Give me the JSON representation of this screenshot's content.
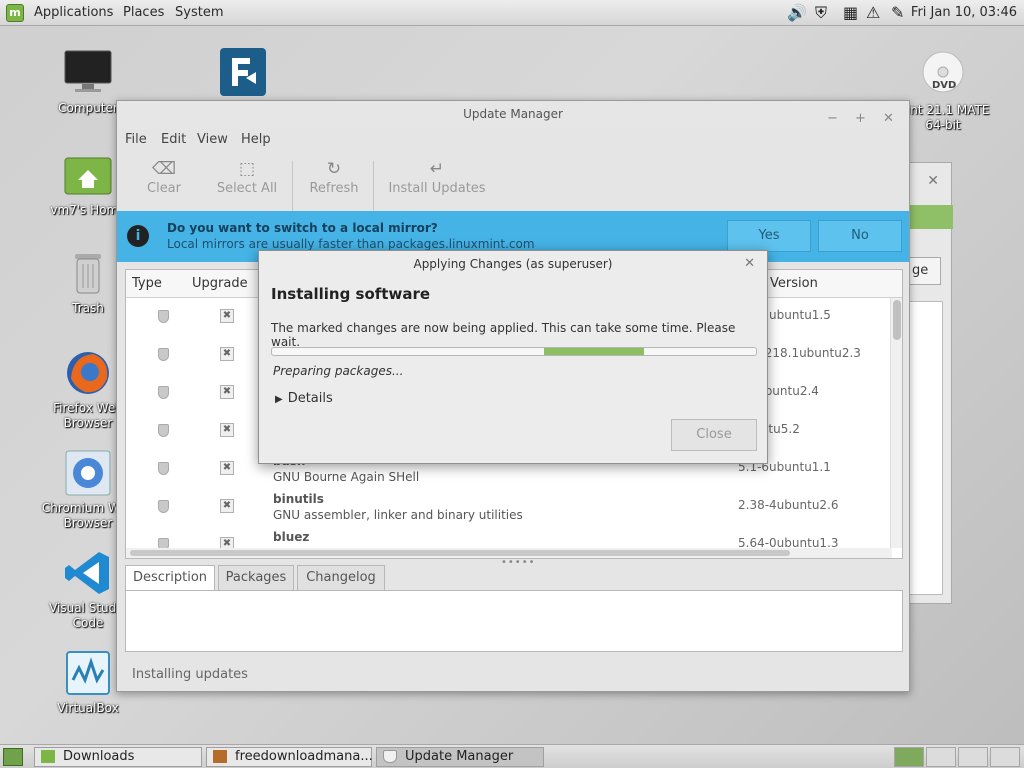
{
  "top_panel": {
    "menus": [
      "Applications",
      "Places",
      "System"
    ],
    "clock": "Fri Jan 10, 03:46"
  },
  "desktop": {
    "icons": [
      {
        "label": "Computer",
        "icon": "monitor-icon"
      },
      {
        "label": "vm7's Home",
        "icon": "home-folder-icon"
      },
      {
        "label": "Trash",
        "icon": "trash-icon"
      },
      {
        "label": "Firefox Web Browser",
        "icon": "firefox-icon"
      },
      {
        "label": "Chromium Web Browser",
        "icon": "chromium-icon"
      },
      {
        "label": "Visual Studio Code",
        "icon": "vscode-icon"
      },
      {
        "label": "VirtualBox",
        "icon": "virtualbox-icon"
      },
      {
        "label": "Mint 21.1 MATE 64-bit",
        "icon": "dvd-icon"
      }
    ]
  },
  "update_manager": {
    "title": "Update Manager",
    "menus": [
      "File",
      "Edit",
      "View",
      "Help"
    ],
    "toolbar": {
      "clear": "Clear",
      "select_all": "Select All",
      "refresh": "Refresh",
      "install": "Install Updates"
    },
    "mirror": {
      "question": "Do you want to switch to a local mirror?",
      "subtext": "Local mirrors are usually faster than packages.linuxmint.com",
      "yes": "Yes",
      "no": "No"
    },
    "columns": {
      "type": "Type",
      "upgrade": "Upgrade",
      "version": "Version"
    },
    "rows": [
      {
        "name": "",
        "desc": "",
        "version": "7.5-2ubuntu1.5"
      },
      {
        "name": "",
        "desc": "",
        "version": "2.91218.1ubuntu2.3"
      },
      {
        "name": "",
        "desc": "",
        "version": "3.2ubuntu2.4"
      },
      {
        "name": "",
        "desc": "",
        "version": "ubuntu5.2"
      },
      {
        "name": "bash",
        "desc": "GNU Bourne Again SHell",
        "version": "5.1-6ubuntu1.1"
      },
      {
        "name": "binutils",
        "desc": "GNU assembler, linker and binary utilities",
        "version": "2.38-4ubuntu2.6"
      },
      {
        "name": "bluez",
        "desc": "",
        "version": "5.64-0ubuntu1.3"
      }
    ],
    "tabs": [
      "Description",
      "Packages",
      "Changelog"
    ],
    "status": "Installing updates"
  },
  "dialog": {
    "title": "Applying Changes (as superuser)",
    "heading": "Installing software",
    "message": "The marked changes are now being applied. This can take some time. Please wait.",
    "state": "Preparing packages...",
    "details": "Details",
    "close": "Close"
  },
  "taskbar": {
    "tasks": [
      "Downloads",
      "freedownloadmana...",
      "Update Manager"
    ]
  },
  "colors": {
    "mirror_bar": "#45b3e6",
    "progress": "#8cbf62",
    "mint_green": "#7db547"
  }
}
